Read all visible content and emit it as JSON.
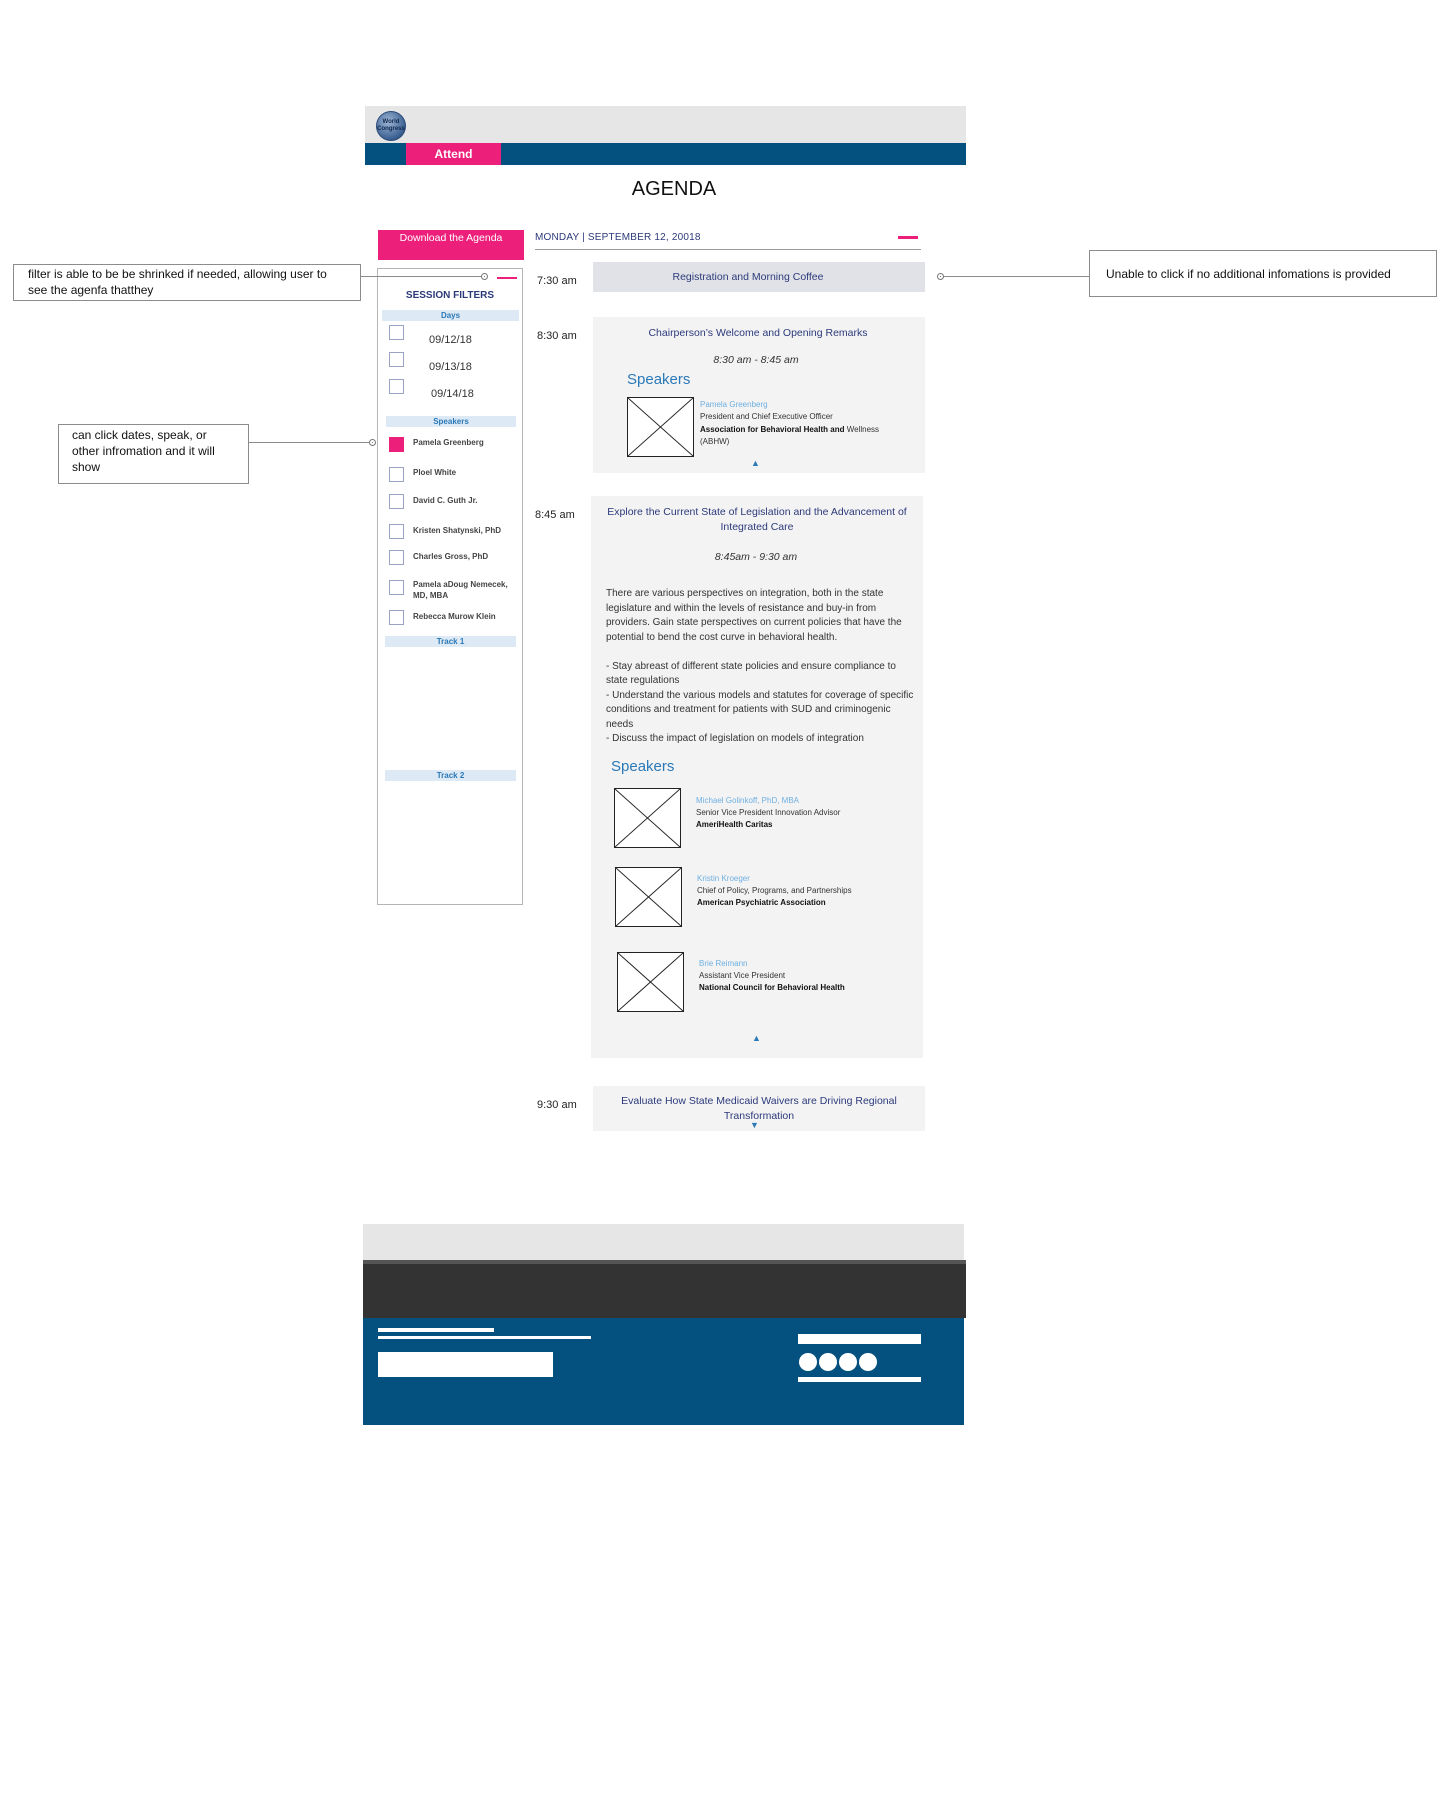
{
  "header": {
    "logo_text": [
      "World",
      "Congress"
    ],
    "nav_active": "Attend"
  },
  "page_title": "AGENDA",
  "download_button": "Download the Agenda",
  "date_header": "MONDAY | SEPTEMBER 12, 20018",
  "filters": {
    "title": "SESSION FILTERS",
    "days_heading": "Days",
    "days": [
      "09/12/18",
      "09/13/18",
      "09/14/18"
    ],
    "speakers_heading": "Speakers",
    "speakers": [
      {
        "label": "Pamela Greenberg",
        "checked": true
      },
      {
        "label": "Ploel White",
        "checked": false
      },
      {
        "label": "David C. Guth Jr.",
        "checked": false
      },
      {
        "label": "Kristen Shatynski, PhD",
        "checked": false
      },
      {
        "label": "Charles Gross, PhD",
        "checked": false
      },
      {
        "label": "Pamela aDoug Nemecek, MD, MBA",
        "checked": false
      },
      {
        "label": "Rebecca Murow Klein",
        "checked": false
      }
    ],
    "track1": "Track 1",
    "track2": "Track 2"
  },
  "sessions": [
    {
      "time": "7:30 am",
      "title": "Registration and Morning Coffee"
    },
    {
      "time": "8:30 am",
      "title": "Chairperson’s Welcome and Opening Remarks",
      "range": "8:30 am - 8:45 am",
      "speakers_heading": "Speakers",
      "speakers": [
        {
          "name": "Pamela Greenberg",
          "role": "President and Chief Executive Officer",
          "org_bold": "Association for Behavioral Health and",
          "org_rest": " Wellness (ABHW)"
        }
      ]
    },
    {
      "time": "8:45 am",
      "title": "Explore the Current State of Legislation and the Advancement of Integrated Care",
      "range": "8:45am - 9:30 am",
      "description": "There are various perspectives on integration, both in the state legislature and within the levels of resistance and buy-in from providers. Gain state perspectives on current policies that have the potential to bend the cost curve in behavioral health.\n\n- Stay abreast of different state policies and ensure compliance to state regulations\n- Understand the various models and statutes for coverage of specific conditions and treatment for patients with SUD and criminogenic needs\n- Discuss the impact of legislation on models of integration",
      "speakers_heading": "Speakers",
      "speakers": [
        {
          "name": "Michael Golinkoff, PhD, MBA",
          "role": "Senior Vice President Innovation Advisor",
          "org": "AmeriHealth Caritas"
        },
        {
          "name": "Kristin Kroeger",
          "role": "Chief of Policy, Programs, and Partnerships",
          "org": "American Psychiatric Association"
        },
        {
          "name": "Brie Reimann",
          "role": "Assistant Vice President",
          "org": "National Council for Behavioral Health"
        }
      ]
    },
    {
      "time": "9:30 am",
      "title": "Evaluate How State Medicaid Waivers are Driving Regional Transformation"
    }
  ],
  "annotations": {
    "filter_note": "filter is able to be be shrinked if needed, allowing user to see the agenfa thatthey",
    "click_note": "can click dates, speak, or other infromation and it will show",
    "unclickable_note": "Unable to click if no additional infomations is provided"
  },
  "colors": {
    "brand_pink": "#ec1f7a",
    "brand_blue": "#04507e",
    "title_navy": "#2c3a7a",
    "link_blue": "#2a79b8"
  },
  "icons": {
    "collapse": "minus-icon",
    "expand": "triangle-up-icon",
    "collapse_session": "triangle-down-icon"
  }
}
